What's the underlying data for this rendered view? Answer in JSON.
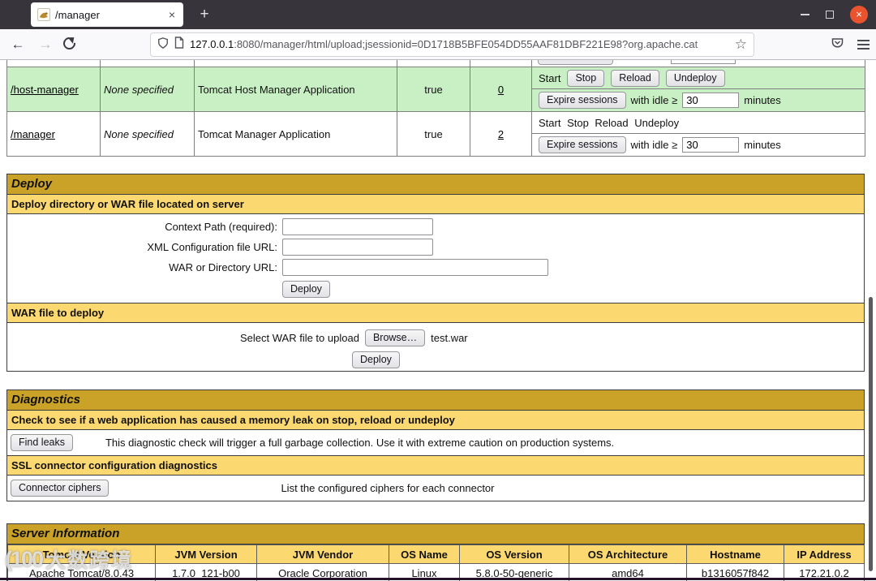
{
  "browser": {
    "tab_title": "/manager",
    "tab_close": "×",
    "new_tab": "+",
    "win_close": "×",
    "back": "←",
    "forward": "→",
    "url_domain": "127.0.0.1",
    "url_rest": ":8080/manager/html/upload;jsessionid=0D1718B5BFE054DD55AAF81DBF221E98?org.apache.cat",
    "star": "☆"
  },
  "apps": {
    "rows": [
      {
        "path": "/host-manager",
        "version": "None specified",
        "display_name": "Tomcat Host Manager Application",
        "running": "true",
        "sessions": "0",
        "start": "Start",
        "stop": "Stop",
        "reload": "Reload",
        "undeploy": "Undeploy",
        "expire": "Expire sessions",
        "idle_label": "with idle ≥",
        "idle_value": "30",
        "minutes": "minutes"
      },
      {
        "path": "/manager",
        "version": "None specified",
        "display_name": "Tomcat Manager Application",
        "running": "true",
        "sessions": "2",
        "commands_text": "Start Stop Reload Undeploy",
        "expire": "Expire sessions",
        "idle_label": "with idle ≥",
        "idle_value": "30",
        "minutes": "minutes"
      }
    ]
  },
  "deploy": {
    "title": "Deploy",
    "server_subtitle": "Deploy directory or WAR file located on server",
    "context_label": "Context Path (required):",
    "xml_label": "XML Configuration file URL:",
    "war_label": "WAR or Directory URL:",
    "deploy_button": "Deploy",
    "war_subtitle": "WAR file to deploy",
    "select_label": "Select WAR file to upload",
    "browse_button": "Browse…",
    "file_name": "test.war",
    "upload_button": "Deploy"
  },
  "diagnostics": {
    "title": "Diagnostics",
    "leak_subtitle": "Check to see if a web application has caused a memory leak on stop, reload or undeploy",
    "find_leaks_button": "Find leaks",
    "leak_text": "This diagnostic check will trigger a full garbage collection. Use it with extreme caution on production systems.",
    "ssl_subtitle": "SSL connector configuration diagnostics",
    "ciphers_button": "Connector ciphers",
    "ciphers_text": "List the configured ciphers for each connector"
  },
  "server_info": {
    "title": "Server Information",
    "columns": [
      "Tomcat Version",
      "JVM Version",
      "JVM Vendor",
      "OS Name",
      "OS Version",
      "OS Architecture",
      "Hostname",
      "IP Address"
    ],
    "values": [
      "Apache Tomcat/8.0.43",
      "1.7.0_121-b00",
      "Oracle Corporation",
      "Linux",
      "5.8.0-50-generic",
      "amd64",
      "b1316057f842",
      "172.21.0.2"
    ]
  },
  "watermark": {
    "logo": "(100",
    "text": "大数跨境"
  },
  "colors": {
    "title_gold": "#C9A227",
    "sub_gold": "#FCD870",
    "row_green": "#C9F0C4",
    "titlebar": "#38343C",
    "ubuntu_orange": "#E9542F"
  }
}
